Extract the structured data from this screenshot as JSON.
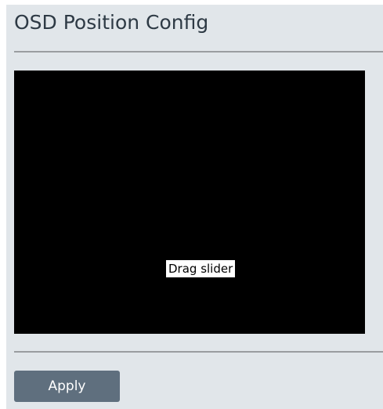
{
  "page": {
    "title": "OSD Position Config"
  },
  "preview": {
    "drag_label": "Drag slider",
    "background_color": "#000000"
  },
  "actions": {
    "apply_label": "Apply"
  },
  "colors": {
    "panel_background": "#e1e6ea",
    "button_background": "#5f6f7e",
    "title_text": "#2e3a45"
  }
}
